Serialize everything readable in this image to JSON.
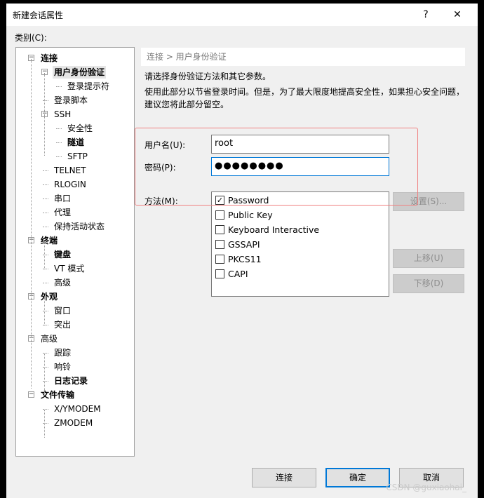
{
  "window": {
    "title": "新建会话属性",
    "help": "?",
    "close": "✕"
  },
  "category_label": "类别(C):",
  "tree": [
    {
      "label": "连接",
      "level": 0,
      "bold": true,
      "expander": true
    },
    {
      "label": "用户身份验证",
      "level": 1,
      "bold": true,
      "expander": true,
      "selected": true
    },
    {
      "label": "登录提示符",
      "level": 2
    },
    {
      "label": "登录脚本",
      "level": 1
    },
    {
      "label": "SSH",
      "level": 1,
      "expander": true
    },
    {
      "label": "安全性",
      "level": 2
    },
    {
      "label": "隧道",
      "level": 2,
      "bold": true
    },
    {
      "label": "SFTP",
      "level": 2
    },
    {
      "label": "TELNET",
      "level": 1
    },
    {
      "label": "RLOGIN",
      "level": 1
    },
    {
      "label": "串口",
      "level": 1
    },
    {
      "label": "代理",
      "level": 1
    },
    {
      "label": "保持活动状态",
      "level": 1
    },
    {
      "label": "终端",
      "level": 0,
      "bold": true,
      "expander": true
    },
    {
      "label": "键盘",
      "level": 1,
      "bold": true
    },
    {
      "label": "VT 模式",
      "level": 1
    },
    {
      "label": "高级",
      "level": 1
    },
    {
      "label": "外观",
      "level": 0,
      "bold": true,
      "expander": true
    },
    {
      "label": "窗口",
      "level": 1
    },
    {
      "label": "突出",
      "level": 1
    },
    {
      "label": "高级",
      "level": 0,
      "expander": true
    },
    {
      "label": "跟踪",
      "level": 1
    },
    {
      "label": "响铃",
      "level": 1
    },
    {
      "label": "日志记录",
      "level": 1,
      "bold": true
    },
    {
      "label": "文件传输",
      "level": 0,
      "bold": true,
      "expander": true
    },
    {
      "label": "X/YMODEM",
      "level": 1
    },
    {
      "label": "ZMODEM",
      "level": 1
    }
  ],
  "breadcrumb": "连接 > 用户身份验证",
  "desc1": "请选择身份验证方法和其它参数。",
  "desc2": "使用此部分以节省登录时间。但是，为了最大限度地提高安全性，如果担心安全问题，",
  "desc3": "建议您将此部分留空。",
  "username": {
    "label": "用户名(U):",
    "value": "root"
  },
  "password": {
    "label": "密码(P):",
    "value": "●●●●●●●●"
  },
  "method": {
    "label": "方法(M):",
    "items": [
      {
        "label": "Password",
        "checked": true
      },
      {
        "label": "Public Key",
        "checked": false
      },
      {
        "label": "Keyboard Interactive",
        "checked": false
      },
      {
        "label": "GSSAPI",
        "checked": false
      },
      {
        "label": "PKCS11",
        "checked": false
      },
      {
        "label": "CAPI",
        "checked": false
      }
    ]
  },
  "buttons": {
    "settings": "设置(S)...",
    "up": "上移(U)",
    "down": "下移(D)",
    "connect": "连接",
    "ok": "确定",
    "cancel": "取消"
  },
  "watermark": "CSDN @guxiaohai_",
  "colors": {
    "accent": "#0078d7",
    "highlight_box": "#f08080"
  }
}
